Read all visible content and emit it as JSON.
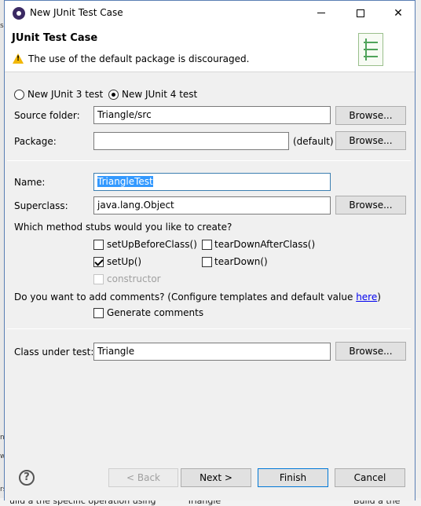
{
  "window": {
    "title": "New JUnit Test Case"
  },
  "header": {
    "title": "JUnit Test Case",
    "message": "The use of the default package is discouraged."
  },
  "version": {
    "junit3_label": "New JUnit 3 test",
    "junit4_label": "New JUnit 4 test",
    "selected": "junit4"
  },
  "source_folder": {
    "label": "Source folder:",
    "value": "Triangle/src",
    "browse": "Browse..."
  },
  "package": {
    "label": "Package:",
    "value": "",
    "suffix": "(default)",
    "browse": "Browse..."
  },
  "name": {
    "label": "Name:",
    "value": "TriangleTest"
  },
  "superclass": {
    "label": "Superclass:",
    "value": "java.lang.Object",
    "browse": "Browse..."
  },
  "stubs": {
    "question": "Which method stubs would you like to create?",
    "setUpBeforeClass": {
      "label": "setUpBeforeClass()",
      "checked": false
    },
    "tearDownAfterClass": {
      "label": "tearDownAfterClass()",
      "checked": false
    },
    "setUp": {
      "label": "setUp()",
      "checked": true
    },
    "tearDown": {
      "label": "tearDown()",
      "checked": false
    },
    "constructor": {
      "label": "constructor",
      "checked": false,
      "enabled": false
    }
  },
  "comments": {
    "question_prefix": "Do you want to add comments? (Configure templates and default value ",
    "link": "here",
    "question_suffix": ")",
    "generate_label": "Generate comments",
    "checked": false
  },
  "class_under_test": {
    "label": "Class under test:",
    "value": "Triangle",
    "browse": "Browse..."
  },
  "footer": {
    "back": "< Back",
    "next": "Next >",
    "finish": "Finish",
    "cancel": "Cancel"
  },
  "background": {
    "left_fragments": [
      "st",
      "n",
      "w",
      "rs"
    ],
    "bottom_fragments": [
      "uild a the specific operation using",
      "Triangle",
      "Build a the"
    ]
  }
}
